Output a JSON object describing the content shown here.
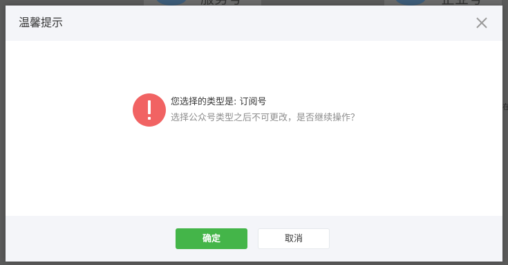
{
  "background": {
    "card1_label": "服务号",
    "card2_label": "企业号",
    "edge_char_right": "在"
  },
  "dialog": {
    "title": "温馨提示",
    "close_icon": "close-icon",
    "message_primary": "您选择的类型是: 订阅号",
    "message_secondary": "选择公众号类型之后不可更改，是否继续操作？",
    "warning_icon": "exclamation-icon",
    "confirm_label": "确定",
    "cancel_label": "取消"
  },
  "colors": {
    "accent_green": "#44b549",
    "warning_red": "#f16363"
  }
}
